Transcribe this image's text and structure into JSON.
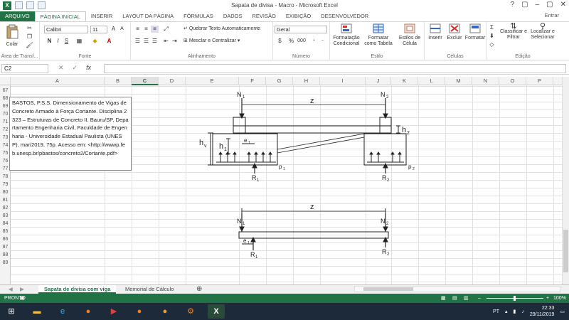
{
  "window": {
    "title": "Sapata de divisa - Macro - Microsoft Excel",
    "signin": "Entrar",
    "controls": [
      "?",
      "▢",
      "–",
      "▢",
      "✕"
    ]
  },
  "tabs": [
    "ARQUIVO",
    "PÁGINA INICIAL",
    "INSERIR",
    "LAYOUT DA PÁGINA",
    "FÓRMULAS",
    "DADOS",
    "REVISÃO",
    "EXIBIÇÃO",
    "DESENVOLVEDOR"
  ],
  "ribbon": {
    "clipboard": {
      "label": "Área de Transf...",
      "paste": "Colar"
    },
    "font": {
      "label": "Fonte",
      "name": "Calibri",
      "size": "11",
      "bold": "N",
      "italic": "I",
      "underline": "S"
    },
    "alignment": {
      "label": "Alinhamento",
      "wrap": "Quebrar Texto Automaticamente",
      "merge": "Mesclar e Centralizar"
    },
    "number": {
      "label": "Número",
      "format": "Geral",
      "percent": "%",
      "thousands": "000"
    },
    "styles": {
      "label": "Estilo",
      "conditional": "Formatação Condicional",
      "table": "Formatar como Tabela",
      "cellstyles": "Estilos de Célula"
    },
    "cells": {
      "label": "Células",
      "insert": "Inserir",
      "delete": "Excluir",
      "format": "Formatar"
    },
    "editing": {
      "label": "Edição",
      "sort": "Classificar e Filtrar",
      "find": "Localizar e Selecionar"
    }
  },
  "formula_bar": {
    "namebox": "C2",
    "cancel": "✕",
    "enter": "✓",
    "fx": "fx",
    "content": ""
  },
  "columns": [
    "A",
    "B",
    "C",
    "D",
    "E",
    "F",
    "G",
    "H",
    "I",
    "J",
    "K",
    "L",
    "M",
    "N",
    "O",
    "P"
  ],
  "active_column": "C",
  "rows": [
    "67",
    "68",
    "69",
    "70",
    "71",
    "72",
    "73",
    "74",
    "75",
    "76",
    "77",
    "78",
    "79",
    "80",
    "81",
    "82",
    "83",
    "84",
    "85",
    "86",
    "87",
    "88",
    "89"
  ],
  "note_text": "BASTOS, P.S.S. Dimensionamento de Vigas de Concreto Armado à Força Cortante. Disciplina 2323 – Estruturas de Concreto II. Bauru/SP, Departamento Engenharia Civil, Faculdade de Engenharia - Universidade Estadual Paulista (UNESP), mar/2019, 75p. Acesso em: <http://wwwp.feb.unesp.br/pbastos/concreto2/Cortante.pdf>",
  "drawing": {
    "labels": {
      "N1": "N",
      "N2": "N",
      "sub1": "1",
      "sub2": "2",
      "z": "z",
      "hv": "h",
      "hv_sub": "v",
      "h1": "h",
      "h1_sub": "1",
      "h2": "h",
      "h2_sub": "2",
      "e1": "e",
      "e1_sub": "1",
      "p1": "p",
      "p1_sub": "1",
      "p2": "p",
      "p2_sub": "2",
      "R1": "R",
      "R1_sub": "1",
      "R2": "R",
      "R2_sub": "2"
    }
  },
  "sheets": [
    "Sapata de divisa com viga",
    "Memorial de Cálculo"
  ],
  "active_sheet": "Sapata de divisa com viga",
  "status": {
    "state": "PRONTO",
    "zoom": "100%"
  },
  "tray": {
    "lang": "PT",
    "time": "22:33",
    "date": "29/11/2019"
  },
  "colors": {
    "excel_green": "#217346",
    "taskbar": "#1c2a3a"
  }
}
